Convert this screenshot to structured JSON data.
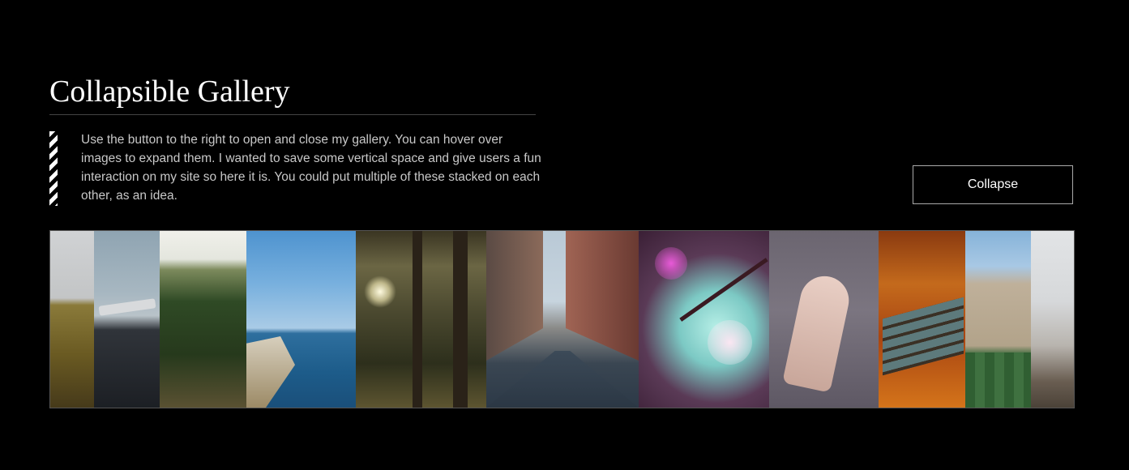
{
  "header": {
    "title": "Collapsible Gallery"
  },
  "intro": {
    "text": "Use the button to the right to open and close my gallery. You can hover over images to expand them. I wanted to save some vertical space and give users a fun interaction on my site so here it is. You could put multiple of these stacked on each other, as an idea."
  },
  "controls": {
    "toggle_label": "Collapse"
  },
  "gallery": {
    "images": [
      {
        "subject": "wheat-field"
      },
      {
        "subject": "plane-wreck-black-sand"
      },
      {
        "subject": "forest-hills"
      },
      {
        "subject": "coastal-cliffs"
      },
      {
        "subject": "sunlit-forest"
      },
      {
        "subject": "city-street"
      },
      {
        "subject": "cherry-blossoms"
      },
      {
        "subject": "hand-on-rainy-glass"
      },
      {
        "subject": "autumn-bench"
      },
      {
        "subject": "cathedral-lawn"
      },
      {
        "subject": "snowy-hill"
      }
    ]
  },
  "colors": {
    "background": "#000000",
    "title": "#ffffff",
    "body_text": "#c8c8c8",
    "button_border": "#aaaaaa"
  }
}
